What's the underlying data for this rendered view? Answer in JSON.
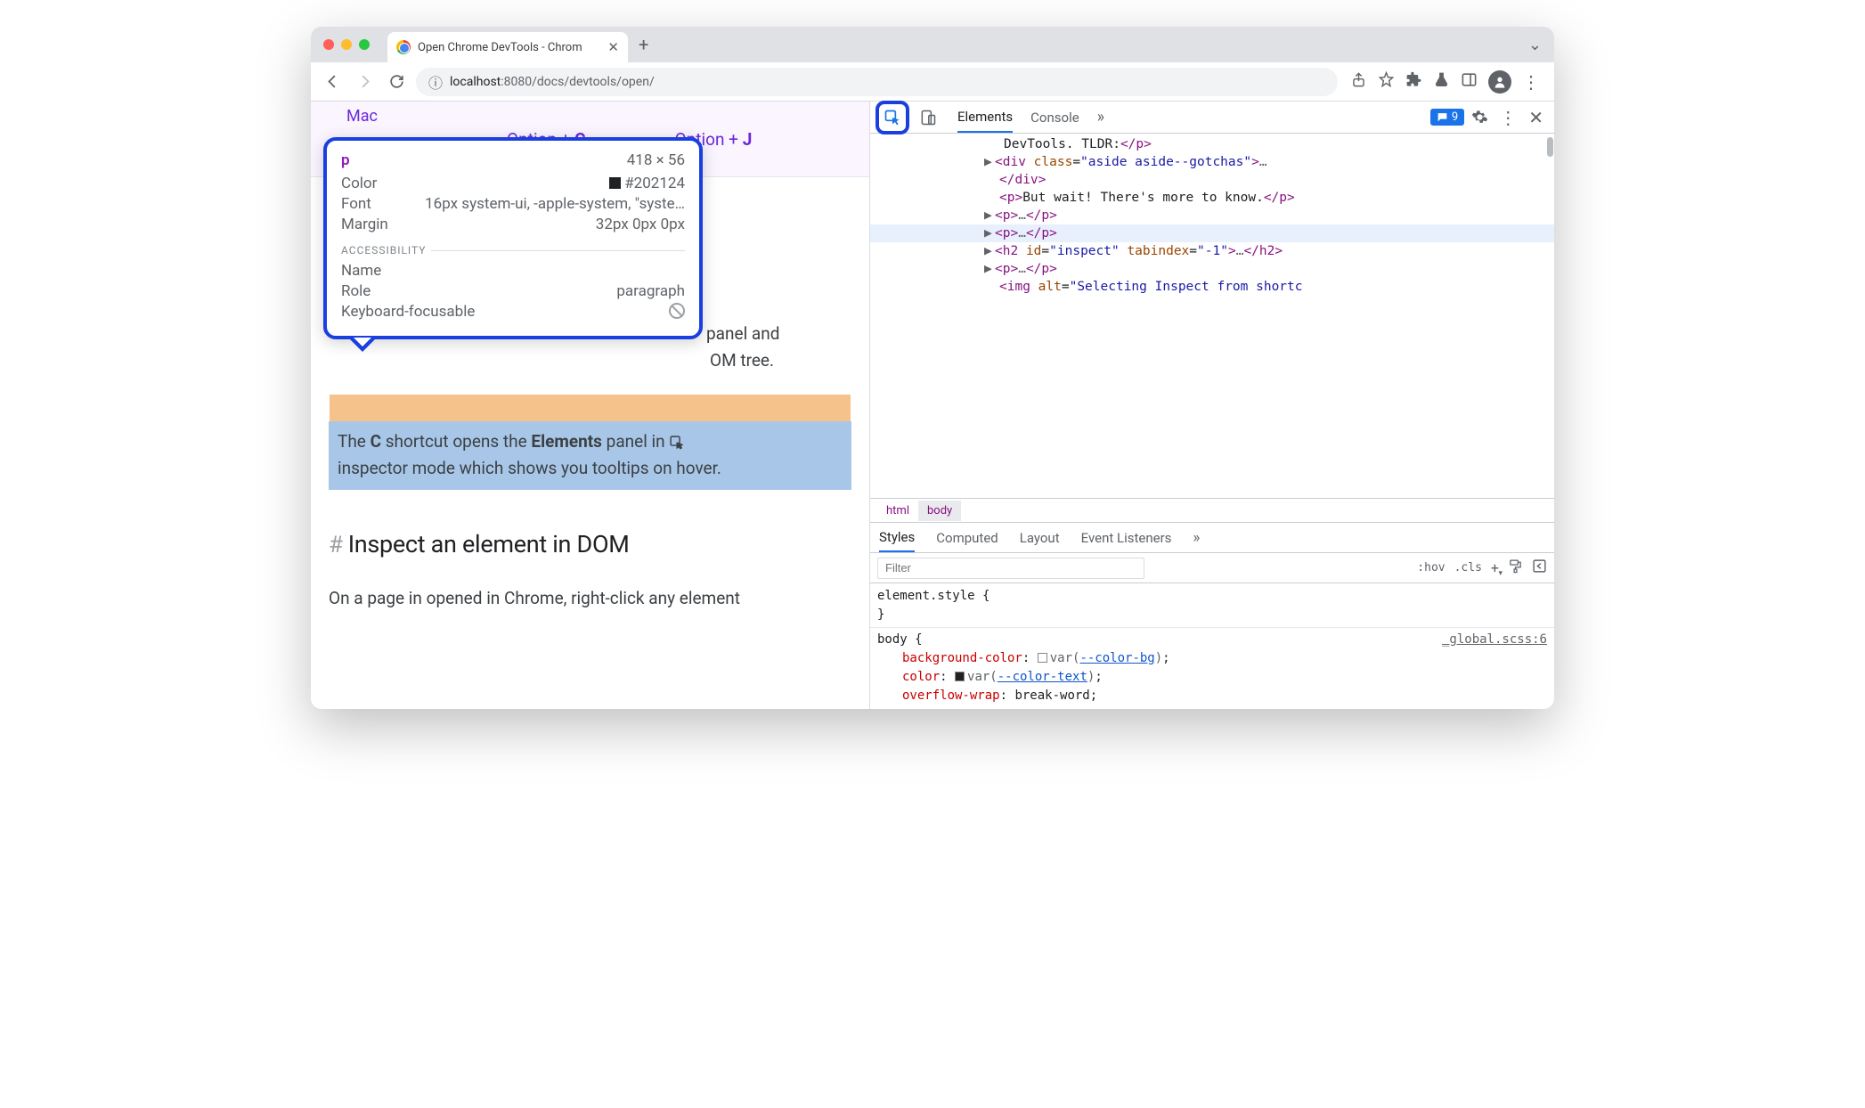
{
  "tab": {
    "title": "Open Chrome DevTools - Chrom"
  },
  "address": {
    "host": "localhost",
    "path": ":8080/docs/devtools/open/"
  },
  "page": {
    "mac_label": "Mac",
    "shortcut_c": "Option + ",
    "shortcut_c_key": "C",
    "shortcut_j": "Option + ",
    "shortcut_j_key": "J",
    "behind_text1": " panel and",
    "behind_text2": "OM tree.",
    "para_hl_pre": "The ",
    "para_hl_key": "C",
    "para_hl_mid": " shortcut opens the ",
    "para_hl_bold": "Elements",
    "para_hl_post": " panel in ",
    "para_hl_line2": "inspector mode which shows you tooltips on hover.",
    "heading": "Inspect an element in DOM",
    "body_text": "On a page in opened in Chrome, right-click any element"
  },
  "tooltip": {
    "tag": "p",
    "dims": "418 × 56",
    "color_label": "Color",
    "color_value": "#202124",
    "font_label": "Font",
    "font_value": "16px system-ui, -apple-system, \"syste…",
    "margin_label": "Margin",
    "margin_value": "32px 0px 0px",
    "a11y_label": "ACCESSIBILITY",
    "name_label": "Name",
    "role_label": "Role",
    "role_value": "paragraph",
    "kb_label": "Keyboard-focusable"
  },
  "devtools": {
    "tabs": {
      "elements": "Elements",
      "console": "Console"
    },
    "issues_count": "9",
    "dom": {
      "line1_text": "DevTools. TLDR:",
      "line2_attr": "aside aside--gotchas",
      "line3_text": "But wait! There's more to know.",
      "h2_id": "inspect",
      "h2_tabindex": "-1",
      "img_alt": "Selecting Inspect from shortc"
    },
    "breadcrumb": {
      "html": "html",
      "body": "body"
    },
    "styles_tabs": {
      "styles": "Styles",
      "computed": "Computed",
      "layout": "Layout",
      "listeners": "Event Listeners"
    },
    "filter_placeholder": "Filter",
    "filter_hov": ":hov",
    "filter_cls": ".cls",
    "css": {
      "element_style": "element.style",
      "body": "body",
      "link": "_global.scss:6",
      "bg_prop": "background-color",
      "bg_var": "--color-bg",
      "color_prop": "color",
      "color_var": "--color-text",
      "wrap_prop": "overflow-wrap",
      "wrap_val": "break-word"
    }
  }
}
